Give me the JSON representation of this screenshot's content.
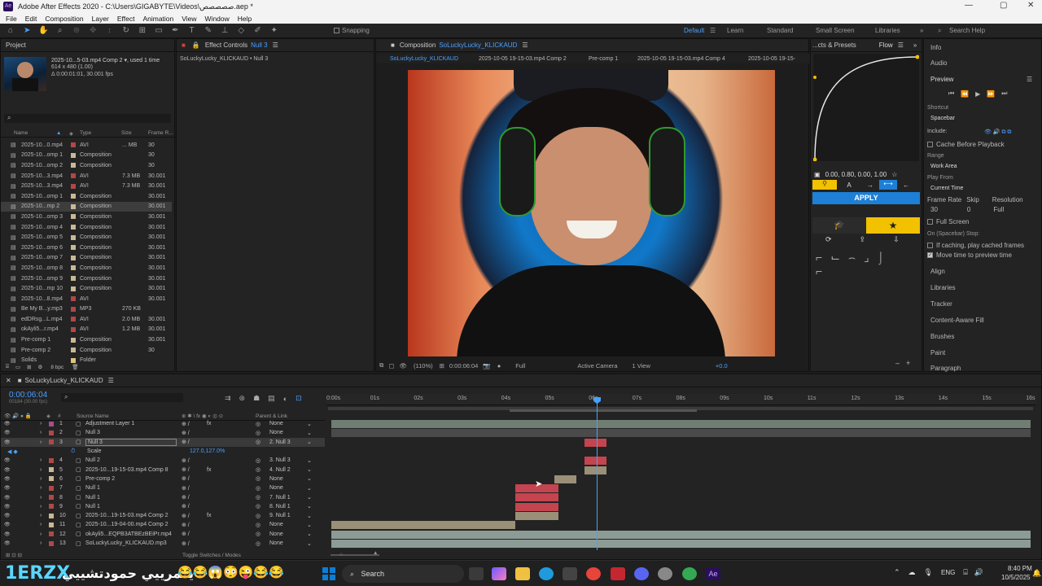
{
  "window": {
    "title": "Adobe After Effects 2020 - C:\\Users\\GIGABYTE\\Videos\\صصصصص.aep *"
  },
  "menu": [
    "File",
    "Edit",
    "Composition",
    "Layer",
    "Effect",
    "Animation",
    "View",
    "Window",
    "Help"
  ],
  "toolbar": {
    "snapping": "Snapping",
    "workspaces": [
      "Default",
      "Learn",
      "Standard",
      "Small Screen",
      "Libraries"
    ],
    "search": "Search Help"
  },
  "project": {
    "tab": "Project",
    "selected_name": "2025-10...5-03.mp4 Comp 2 ▾, used 1 time",
    "selected_dims": "614 x 480 (1.00)",
    "selected_dur": "Δ 0:00:01:01, 30.001 fps",
    "search_icon": "⌕",
    "columns": [
      "Name",
      "Type",
      "Size",
      "Frame R..."
    ],
    "items": [
      {
        "name": "2025-10...0.mp4",
        "type": "AVI",
        "size": "... MB",
        "fps": "30",
        "color": "#b04848"
      },
      {
        "name": "2025-10...omp 1",
        "type": "Composition",
        "size": "",
        "fps": "30",
        "color": "#c9b894"
      },
      {
        "name": "2025-10...omp 2",
        "type": "Composition",
        "size": "",
        "fps": "30",
        "color": "#c9b894"
      },
      {
        "name": "2025-10...3.mp4",
        "type": "AVI",
        "size": "7.3 MB",
        "fps": "30.001",
        "color": "#b04848"
      },
      {
        "name": "2025-10...3.mp4",
        "type": "AVI",
        "size": "7.3 MB",
        "fps": "30.001",
        "color": "#b04848"
      },
      {
        "name": "2025-10...omp 1",
        "type": "Composition",
        "size": "",
        "fps": "30.001",
        "color": "#c9b894"
      },
      {
        "name": "2025-10...mp 2",
        "type": "Composition",
        "size": "",
        "fps": "30.001",
        "color": "#c9b894"
      },
      {
        "name": "2025-10...omp 3",
        "type": "Composition",
        "size": "",
        "fps": "30.001",
        "color": "#c9b894"
      },
      {
        "name": "2025-10...omp 4",
        "type": "Composition",
        "size": "",
        "fps": "30.001",
        "color": "#c9b894"
      },
      {
        "name": "2025-10...omp 5",
        "type": "Composition",
        "size": "",
        "fps": "30.001",
        "color": "#c9b894"
      },
      {
        "name": "2025-10...omp 6",
        "type": "Composition",
        "size": "",
        "fps": "30.001",
        "color": "#c9b894"
      },
      {
        "name": "2025-10...omp 7",
        "type": "Composition",
        "size": "",
        "fps": "30.001",
        "color": "#c9b894"
      },
      {
        "name": "2025-10...omp 8",
        "type": "Composition",
        "size": "",
        "fps": "30.001",
        "color": "#c9b894"
      },
      {
        "name": "2025-10...omp 9",
        "type": "Composition",
        "size": "",
        "fps": "30.001",
        "color": "#c9b894"
      },
      {
        "name": "2025-10...mp 10",
        "type": "Composition",
        "size": "",
        "fps": "30.001",
        "color": "#c9b894"
      },
      {
        "name": "2025-10...8.mp4",
        "type": "AVI",
        "size": "",
        "fps": "30.001",
        "color": "#b04848"
      },
      {
        "name": "Be My B...y.mp3",
        "type": "MP3",
        "size": "270 KB",
        "fps": "",
        "color": "#b04848"
      },
      {
        "name": "edDRsg...L.mp4",
        "type": "AVI",
        "size": "2.0 MB",
        "fps": "30.001",
        "color": "#b04848"
      },
      {
        "name": "okAyli5...r.mp4",
        "type": "AVI",
        "size": "1.2 MB",
        "fps": "30.001",
        "color": "#b04848"
      },
      {
        "name": "Pre-comp 1",
        "type": "Composition",
        "size": "",
        "fps": "30.001",
        "color": "#c9b894"
      },
      {
        "name": "Pre-comp 2",
        "type": "Composition",
        "size": "",
        "fps": "30",
        "color": "#c9b894"
      },
      {
        "name": "Solids",
        "type": "Folder",
        "size": "",
        "fps": "",
        "color": "#d9c77a"
      }
    ],
    "footer": "8 bpc"
  },
  "effect_controls": {
    "tab": "Effect Controls",
    "tab_layer": "Null 3",
    "path": "SoLuckyLucky_KLICKAUD • Null 3"
  },
  "composition": {
    "tab": "Composition",
    "tab_name": "SoLuckyLucky_KLICKAUD",
    "breadcrumbs": [
      "SoLuckyLucky_KLICKAUD",
      "2025-10-05 19-15-03.mp4 Comp 2",
      "Pre-comp 1",
      "2025-10-05 19-15-03.mp4 Comp 4",
      "2025-10-05 19-15-"
    ],
    "zoom": "(110%)",
    "time": "0:00:06:04",
    "resolution": "Full",
    "camera": "Active Camera",
    "view": "1 View",
    "exposure": "+0.0"
  },
  "flow": {
    "tabs": [
      "...cts & Presets",
      "Flow"
    ],
    "values": "0.00, 0.80, 0.00, 1.00",
    "apply": "APPLY",
    "accent": "#f2c100",
    "blue": "#1d7fd6"
  },
  "right_panel": {
    "info": "Info",
    "audio": "Audio",
    "preview": "Preview",
    "shortcut_label": "Shortcut",
    "shortcut": "Spacebar",
    "include": "Include:",
    "cache": "Cache Before Playback",
    "range_label": "Range",
    "range": "Work Area",
    "play_from_label": "Play From",
    "play_from": "Current Time",
    "frame_rate_label": "Frame Rate",
    "skip_label": "Skip",
    "resolution_label": "Resolution",
    "frame_rate": "30",
    "skip": "0",
    "resolution": "Full",
    "full_screen": "Full Screen",
    "stop_label": "On (Spacebar) Stop:",
    "if_caching": "If caching, play cached frames",
    "move_time": "Move time to preview time",
    "panels": [
      "Align",
      "Libraries",
      "Tracker",
      "Content-Aware Fill",
      "Brushes",
      "Paint",
      "Paragraph"
    ]
  },
  "timeline": {
    "tab": "SoLuckyLucky_KLICKAUD",
    "time": "0:00:06:04",
    "frame_sub": "00184 (30.00 fps)",
    "columns": {
      "num": "#",
      "source": "Source Name",
      "parent": "Parent & Link"
    },
    "ruler": [
      "0:00s",
      "01s",
      "02s",
      "03s",
      "04s",
      "05s",
      "06s",
      "07s",
      "08s",
      "09s",
      "10s",
      "11s",
      "12s",
      "13s",
      "14s",
      "15s",
      "16s"
    ],
    "layers": [
      {
        "num": "1",
        "name": "Adjustment Layer 1",
        "parent": "None",
        "color": "#a44e8c",
        "fx": true
      },
      {
        "num": "2",
        "name": "Null 3",
        "parent": "None",
        "color": "#b04848"
      },
      {
        "num": "3",
        "name": "Null 3",
        "parent": "2. Null 3",
        "color": "#b04848",
        "selected": true
      },
      {
        "num": "",
        "name": "Scale",
        "parent": "",
        "value": "127.0,127.0%",
        "prop": true
      },
      {
        "num": "4",
        "name": "Null 2",
        "parent": "3. Null 3",
        "color": "#b04848"
      },
      {
        "num": "5",
        "name": "2025-10...19-15-03.mp4 Comp 8",
        "parent": "4. Null 2",
        "color": "#c9b894",
        "fx": true
      },
      {
        "num": "6",
        "name": "Pre-comp 2",
        "parent": "None",
        "color": "#c9b894"
      },
      {
        "num": "7",
        "name": "Null 1",
        "parent": "None",
        "color": "#b04848"
      },
      {
        "num": "8",
        "name": "Null 1",
        "parent": "7. Null 1",
        "color": "#b04848"
      },
      {
        "num": "9",
        "name": "Null 1",
        "parent": "8. Null 1",
        "color": "#b04848"
      },
      {
        "num": "10",
        "name": "2025-10...19-15-03.mp4 Comp 2",
        "parent": "9. Null 1",
        "color": "#c9b894",
        "fx": true
      },
      {
        "num": "11",
        "name": "2025-10...19-04-00.mp4 Comp 2",
        "parent": "None",
        "color": "#c9b894"
      },
      {
        "num": "12",
        "name": "okAyli5...EQPB3ATBEzBEiPr.mp4",
        "parent": "None",
        "color": "#b04848"
      },
      {
        "num": "13",
        "name": "SoLuckyLucky_KLICKAUD.mp3",
        "parent": "None",
        "color": "#b04848"
      }
    ],
    "toggle_label": "Toggle Switches / Modes"
  },
  "taskbar": {
    "overlay_brand": "1ERZX",
    "overlay_text": ": يعمرييي حمودتشييي",
    "emojis": "😂😂😱😳😜😂😂",
    "search": "Search",
    "lang": "ENG",
    "time": "8:40 PM",
    "date": "10/5/2025"
  }
}
